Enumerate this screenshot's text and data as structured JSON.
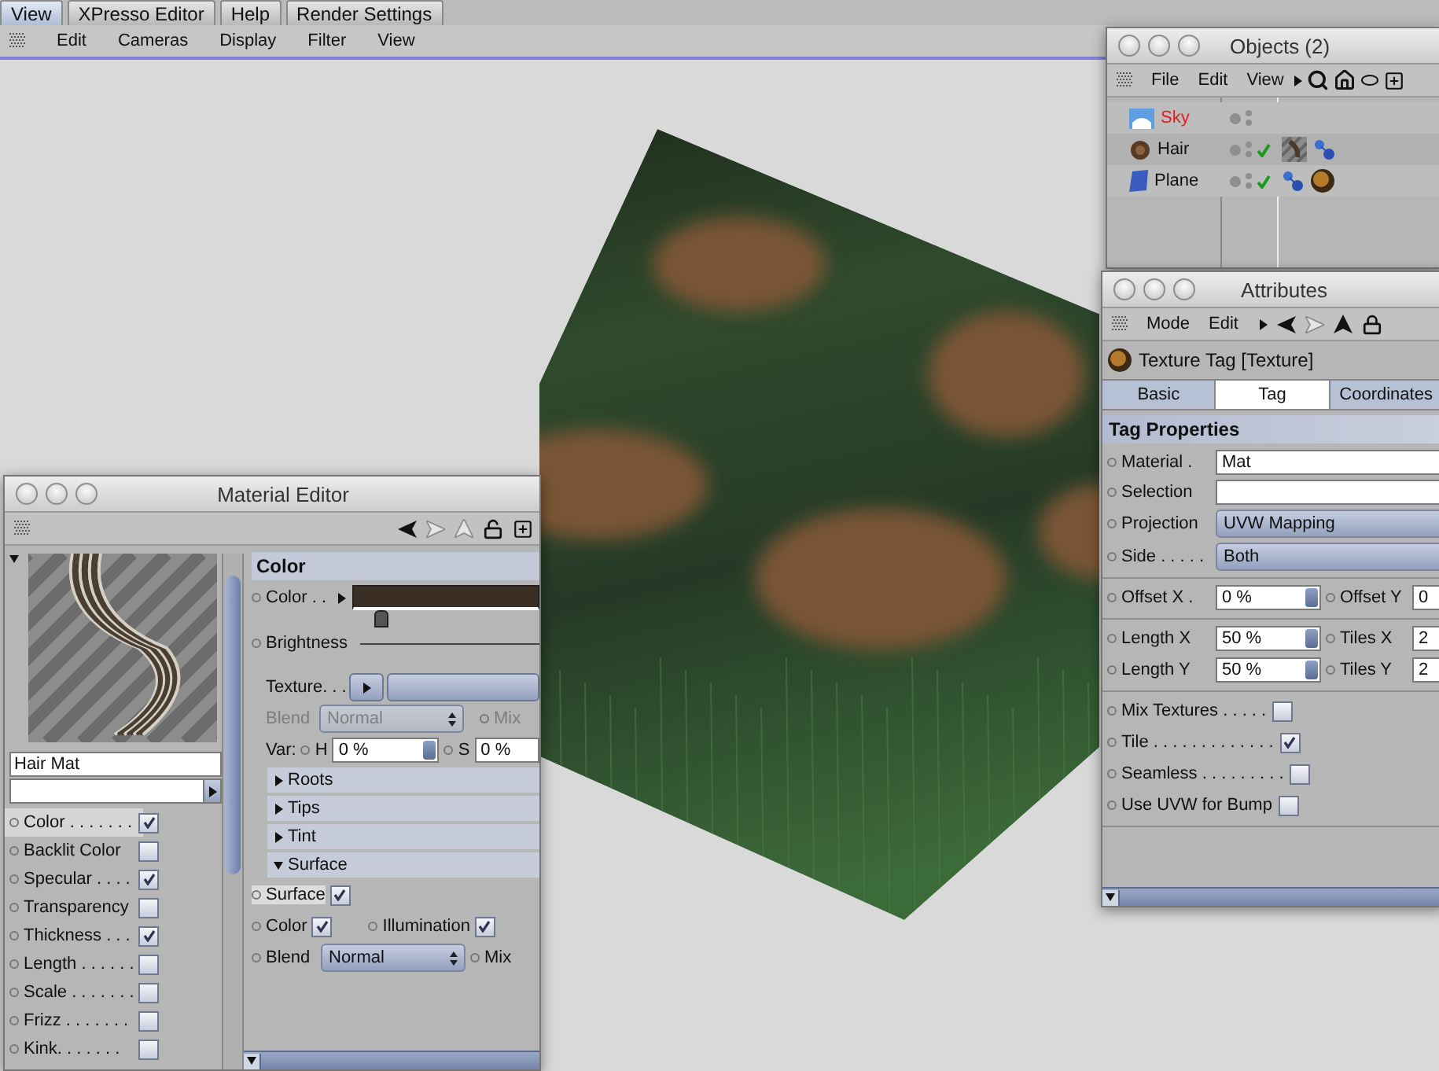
{
  "top_tabs": [
    {
      "label": "View",
      "selected": true
    },
    {
      "label": "XPresso Editor",
      "selected": false
    },
    {
      "label": "Help",
      "selected": false
    },
    {
      "label": "Render Settings",
      "selected": false
    }
  ],
  "viewport_menu": [
    "Edit",
    "Cameras",
    "Display",
    "Filter",
    "View"
  ],
  "objects_window": {
    "title": "Objects (2)",
    "menu": [
      "File",
      "Edit",
      "View"
    ],
    "objects": [
      {
        "name": "Sky",
        "kind": "sky",
        "highlighted": true,
        "checked": false
      },
      {
        "name": "Hair",
        "kind": "hair",
        "highlighted": false,
        "checked": true,
        "tags": [
          {
            "kind": "material"
          },
          {
            "kind": "link"
          }
        ]
      },
      {
        "name": "Plane",
        "kind": "plane",
        "highlighted": false,
        "checked": true,
        "tags": [
          {
            "kind": "link"
          },
          {
            "kind": "texture"
          }
        ]
      }
    ]
  },
  "attributes_window": {
    "title": "Attributes",
    "menu": [
      "Mode",
      "Edit"
    ],
    "header": "Texture Tag [Texture]",
    "tabs": [
      {
        "label": "Basic",
        "selected": false
      },
      {
        "label": "Tag",
        "selected": true
      },
      {
        "label": "Coordinates",
        "selected": false
      }
    ],
    "section": "Tag Properties",
    "fields": [
      {
        "kind": "text",
        "label": "Material .",
        "value": "Mat"
      },
      {
        "kind": "text",
        "label": "Selection"
      },
      {
        "kind": "dropdown",
        "label": "Projection",
        "value": "UVW Mapping"
      },
      {
        "kind": "dropdown",
        "label": "Side . . . . .",
        "value": "Both"
      }
    ],
    "offset_rows": [
      {
        "left": {
          "label": "Offset X .",
          "value": "0 %"
        },
        "right": {
          "label": "Offset Y",
          "value": "0"
        }
      }
    ],
    "length_rows": [
      {
        "left": {
          "label": "Length X",
          "value": "50 %"
        },
        "right": {
          "label": "Tiles X",
          "value": "2"
        }
      },
      {
        "left": {
          "label": "Length Y",
          "value": "50 %"
        },
        "right": {
          "label": "Tiles Y",
          "value": "2"
        }
      }
    ],
    "options": [
      {
        "label": "Mix Textures . . . . .",
        "checked": false
      },
      {
        "label": "Tile . . . . . . . . . . . . .",
        "checked": true
      },
      {
        "label": "Seamless . . . . . . . . .",
        "checked": false
      },
      {
        "label": "Use UVW for Bump",
        "checked": false
      }
    ]
  },
  "material_editor": {
    "title": "Material Editor",
    "name": "Hair Mat",
    "channels": [
      {
        "label": "Color . . . . . . .",
        "checked": true,
        "selected": true
      },
      {
        "label": "Backlit Color",
        "checked": false,
        "selected": false
      },
      {
        "label": "Specular . . . .",
        "checked": true,
        "selected": false
      },
      {
        "label": "Transparency",
        "checked": false,
        "selected": false
      },
      {
        "label": "Thickness . . .",
        "checked": true,
        "selected": false
      },
      {
        "label": "Length . . . . . .",
        "checked": false,
        "selected": false
      },
      {
        "label": "Scale . . . . . . .",
        "checked": false,
        "selected": false
      },
      {
        "label": "Frizz . . . . . . .",
        "checked": false,
        "selected": false
      },
      {
        "label": "Kink. . . . . . .",
        "checked": false,
        "selected": false
      }
    ],
    "color_section": {
      "title": "Color",
      "color_label": "Color . .",
      "color": "#3b2e24",
      "brightness_label": "Brightness",
      "texture_label": "Texture. . .",
      "blend": {
        "label": "Blend",
        "value": "Normal",
        "disabled": true,
        "mix_label": "Mix"
      },
      "var": {
        "label": "Var:",
        "h_label": "H",
        "h_value": "0 %",
        "s_label": "S",
        "s_value": "0 %"
      }
    },
    "groups": [
      {
        "label": "Roots",
        "expanded": false
      },
      {
        "label": "Tips",
        "expanded": false
      },
      {
        "label": "Tint",
        "expanded": false
      },
      {
        "label": "Surface",
        "expanded": true
      }
    ],
    "surface": {
      "surface": {
        "label": "Surface",
        "checked": true
      },
      "color": {
        "label": "Color",
        "checked": true
      },
      "illumination": {
        "label": "Illumination",
        "checked": true
      },
      "blend": {
        "label": "Blend",
        "value": "Normal",
        "disabled": false,
        "mix_label": "Mix"
      }
    }
  }
}
